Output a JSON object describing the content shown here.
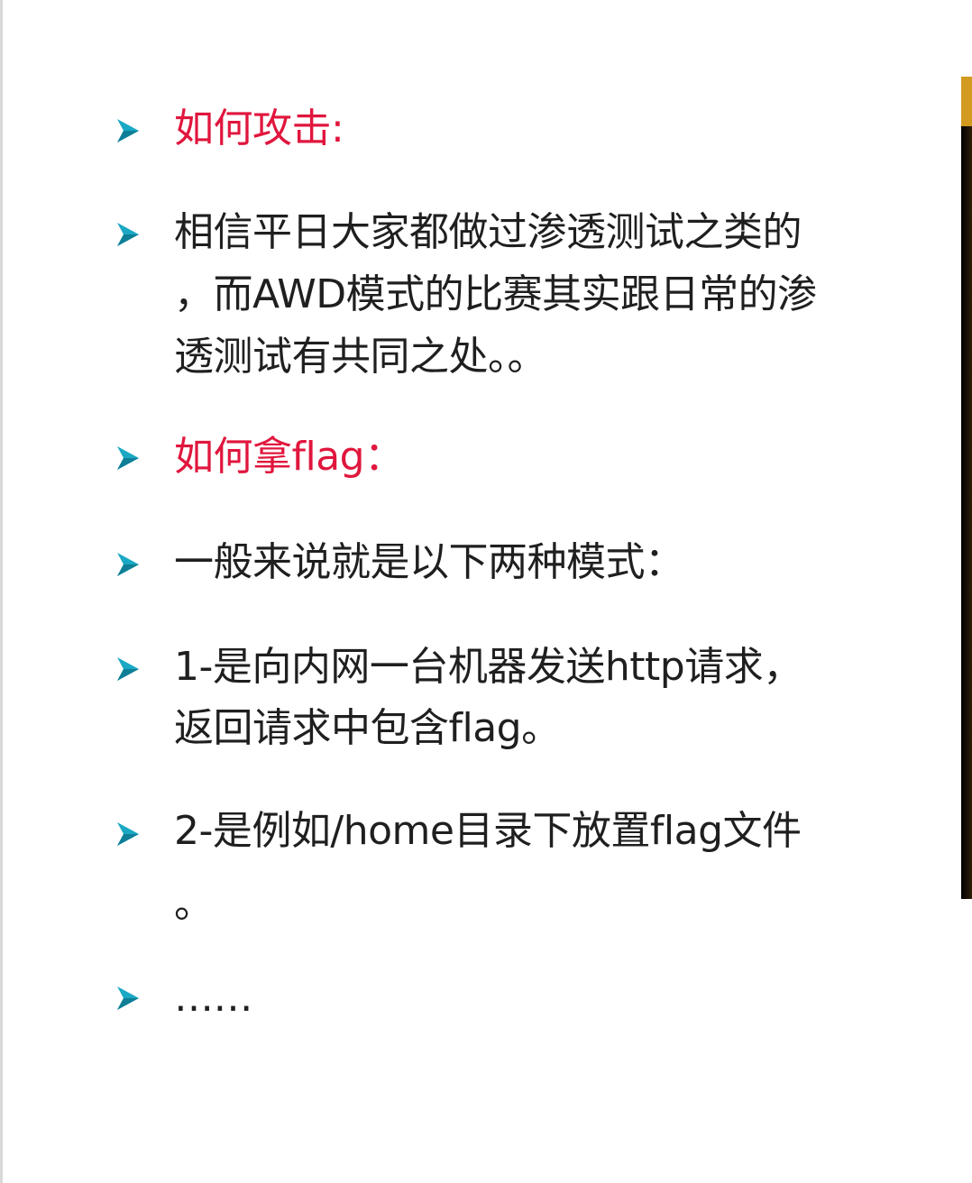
{
  "colors": {
    "heading": "#e0163d",
    "body_text": "#1f1f1f",
    "bullet": "#1aa8c4",
    "bullet_shade": "#0e7f96"
  },
  "bullet_icon": "triangle-arrow-icon",
  "content": {
    "heading_attack": "如何攻击:",
    "attack_desc": [
      "相信平日大家都做过渗透测试之类的",
      "，而AWD模式的比赛其实跟日常的渗",
      "透测试有共同之处。。"
    ],
    "heading_flag": "如何拿flag：",
    "modes_intro": "一般来说就是以下两种模式：",
    "mode_1": [
      "1-是向内网一台机器发送http请求，",
      "返回请求中包含flag。"
    ],
    "mode_2": [
      "2-是例如/home目录下放置flag文件",
      "。"
    ],
    "ellipsis": "……"
  }
}
